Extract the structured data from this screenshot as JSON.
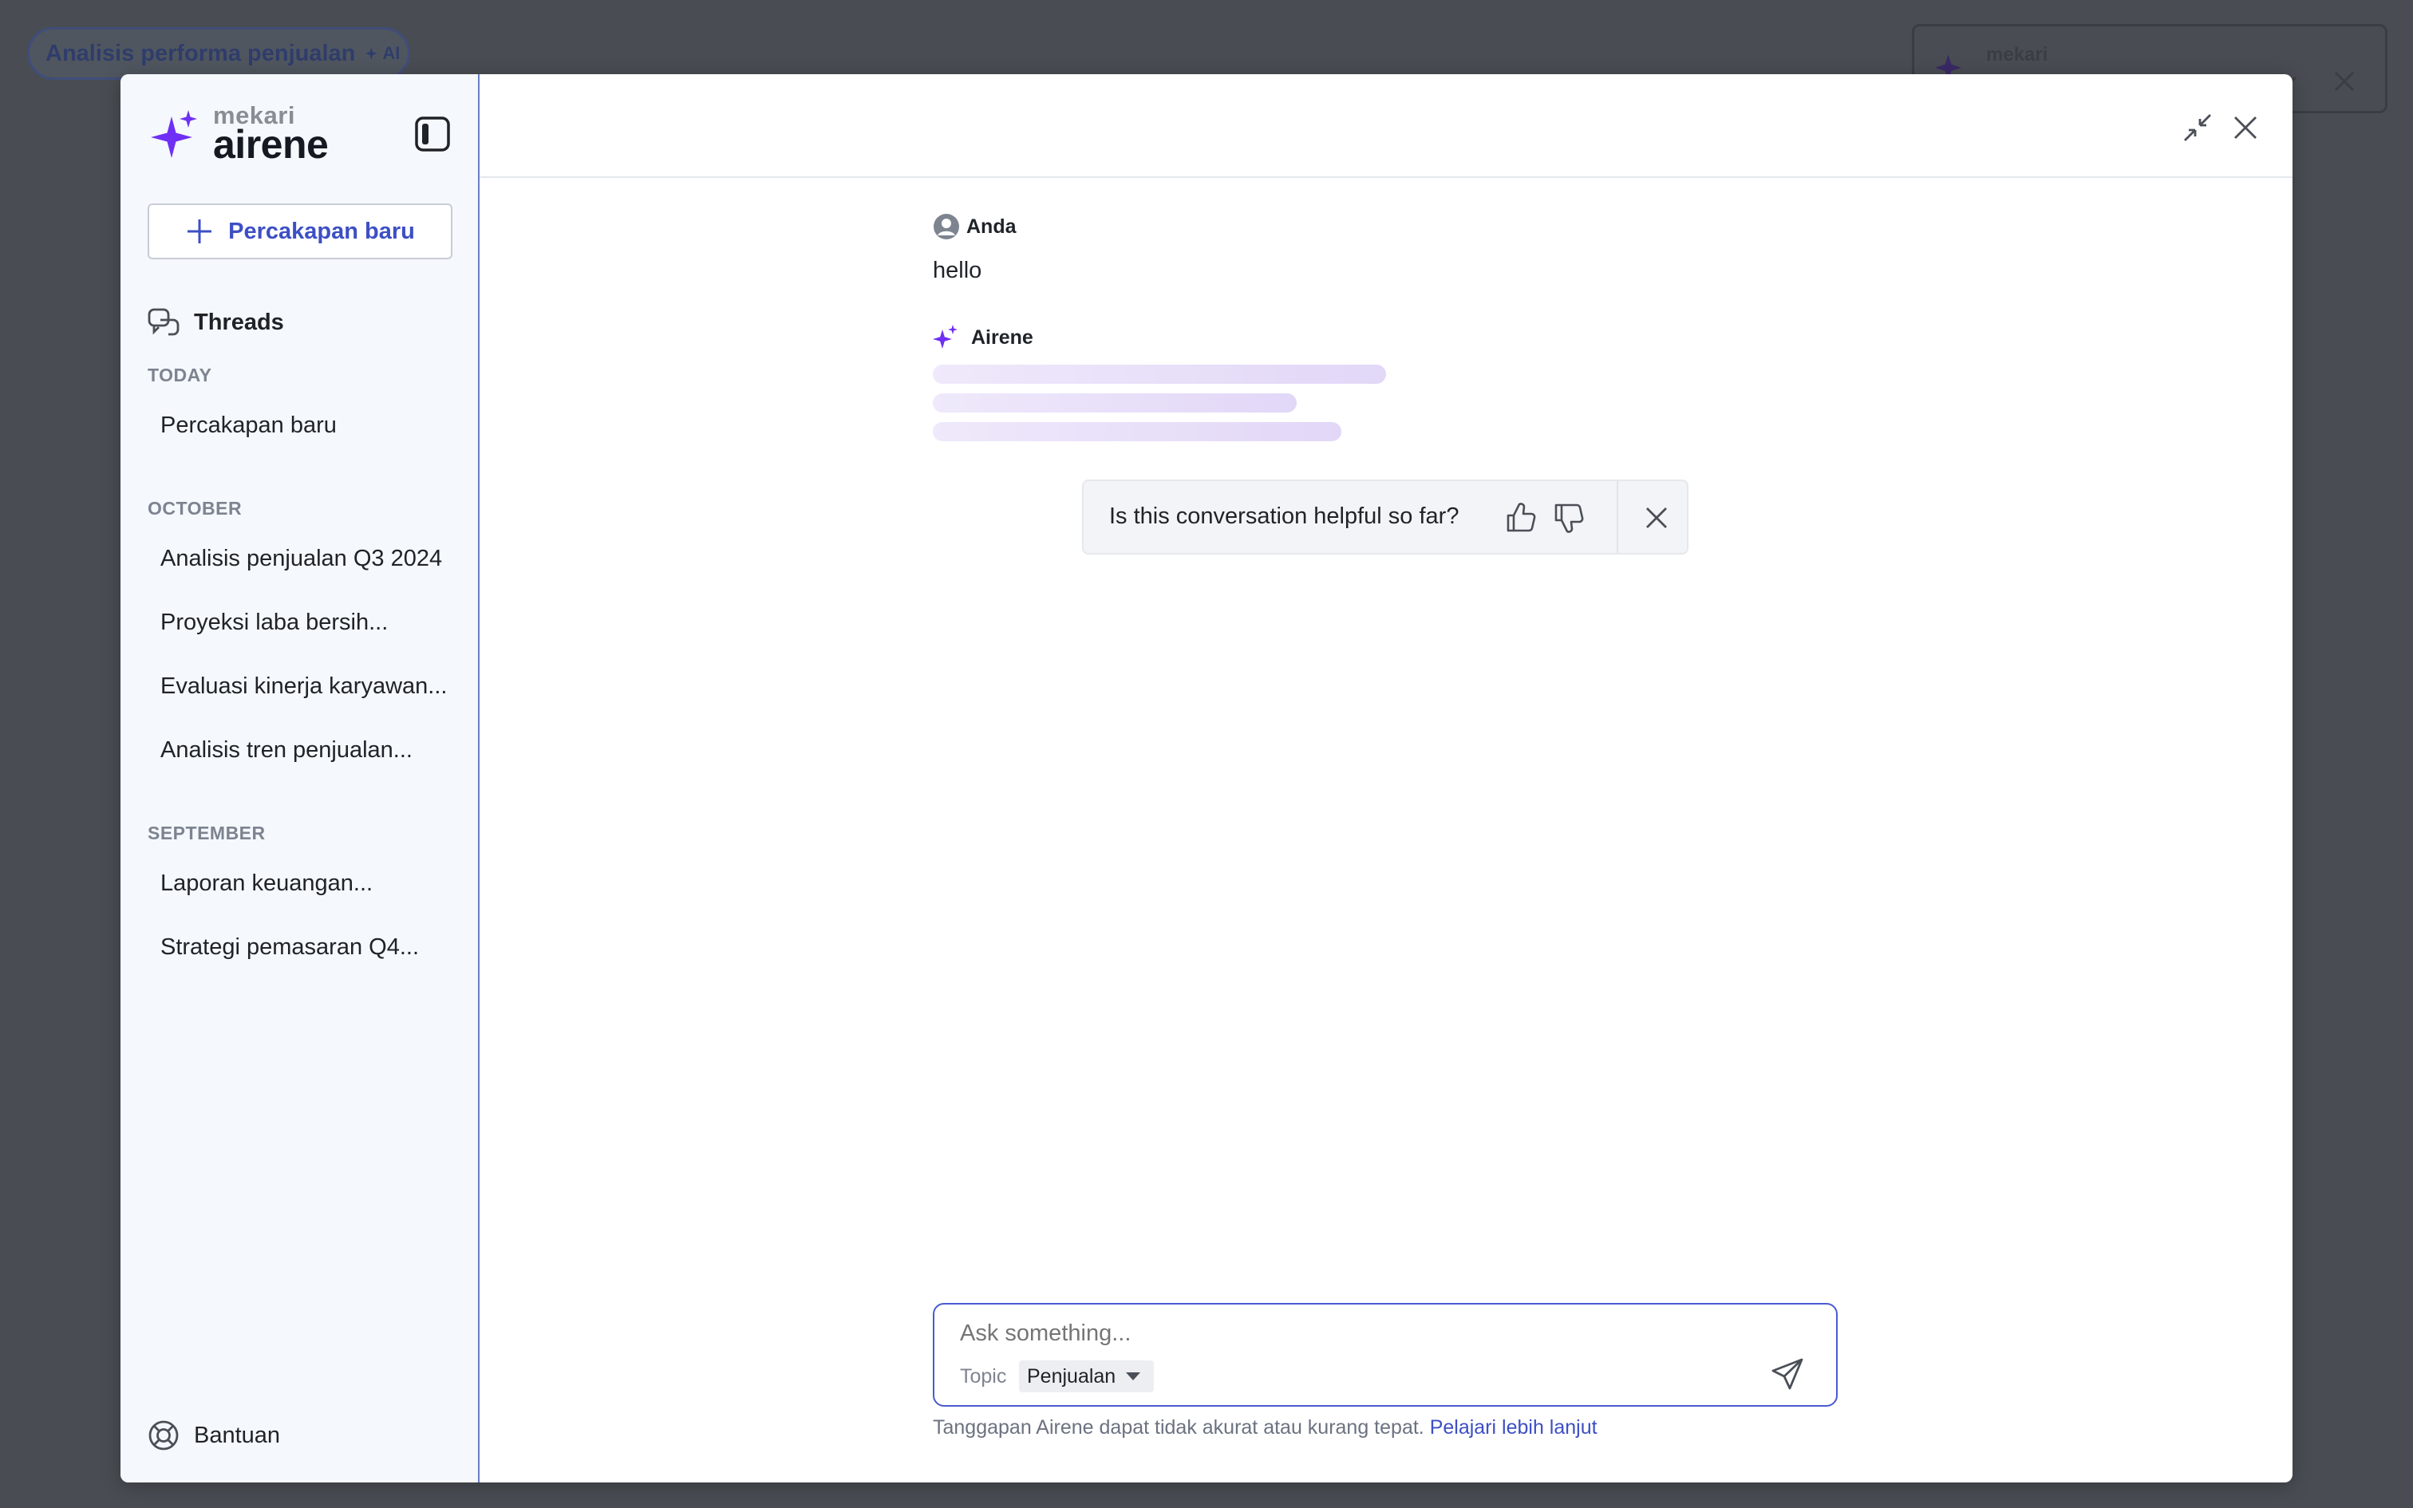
{
  "background": {
    "chip_label": "Analisis performa penjualan",
    "chip_badge": "AI",
    "panel_brand": "mekari"
  },
  "sidebar": {
    "logo": {
      "brand_small": "mekari",
      "brand_large": "airene"
    },
    "new_chat_label": "Percakapan baru",
    "threads_label": "Threads",
    "groups": [
      {
        "label": "TODAY",
        "items": [
          "Percakapan baru"
        ]
      },
      {
        "label": "OCTOBER",
        "items": [
          "Analisis penjualan Q3 2024",
          "Proyeksi laba bersih...",
          "Evaluasi kinerja karyawan...",
          "Analisis tren penjualan..."
        ]
      },
      {
        "label": "SEPTEMBER",
        "items": [
          "Laporan keuangan...",
          "Strategi pemasaran Q4..."
        ]
      }
    ],
    "help_label": "Bantuan"
  },
  "chat": {
    "user_name": "Anda",
    "user_message": "hello",
    "assistant_name": "Airene",
    "feedback_question": "Is this conversation helpful so far?"
  },
  "composer": {
    "placeholder": "Ask something...",
    "topic_label": "Topic",
    "topic_value": "Penjualan"
  },
  "disclaimer": {
    "text": "Tanggapan Airene dapat tidak akurat atau kurang tepat.",
    "link": "Pelajari lebih lanjut"
  },
  "colors": {
    "accent": "#3d4fc4",
    "brand_purple": "#7b2ff7",
    "overlay": "#494d53",
    "sidebar_bg": "#f5f8fc"
  },
  "icons": [
    "sparkle-icon",
    "sidebar-toggle-icon",
    "plus-icon",
    "chat-bubbles-icon",
    "lifebuoy-icon",
    "minimize-icon",
    "close-icon",
    "user-avatar-icon",
    "thumbs-up-icon",
    "thumbs-down-icon",
    "chevron-down-icon",
    "caret-down-icon",
    "send-icon"
  ]
}
